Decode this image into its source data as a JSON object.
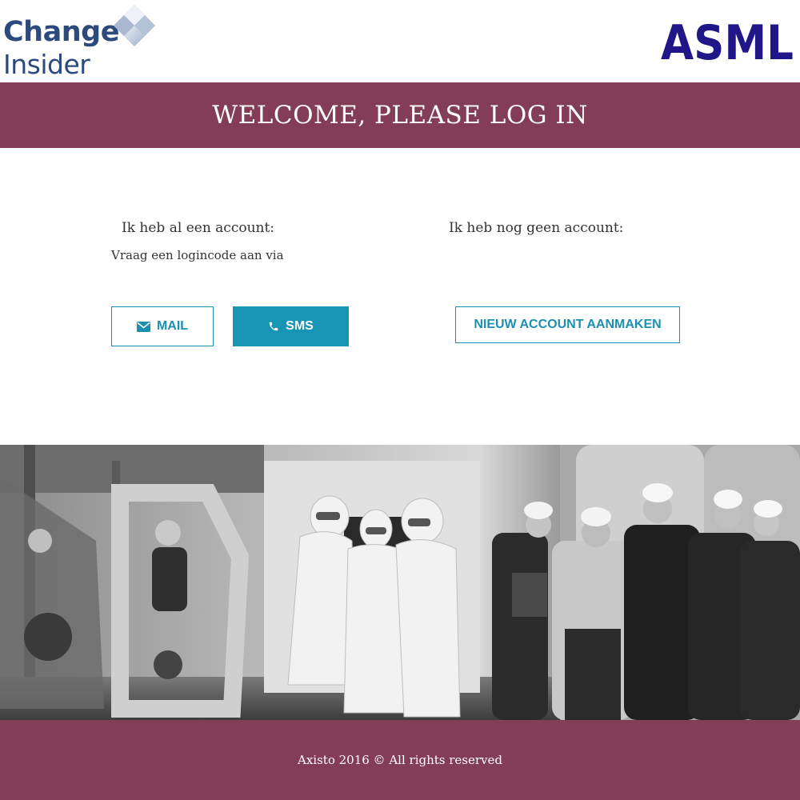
{
  "header": {
    "brand": {
      "line1": "Change",
      "line2": "Insider"
    },
    "partner_logo": "ASML"
  },
  "banner": {
    "title": "WELCOME, PLEASE LOG IN"
  },
  "existing_account": {
    "label": "Ik heb al een account:",
    "sublabel": "Vraag een logincode aan via",
    "mail_button": "MAIL",
    "sms_button": "SMS"
  },
  "new_account": {
    "label": "Ik heb nog geen account:",
    "create_button": "NIEUW ACCOUNT AANMAKEN"
  },
  "footer": {
    "text": "Axisto 2016 © All rights reserved"
  },
  "icons": {
    "mail": "envelope-icon",
    "sms": "phone-icon",
    "brand": "diamond-logo-icon"
  },
  "colors": {
    "banner": "#843d57",
    "accent": "#1895b5",
    "brand_text": "#2c4a7c",
    "asml_blue": "#1f1788"
  }
}
